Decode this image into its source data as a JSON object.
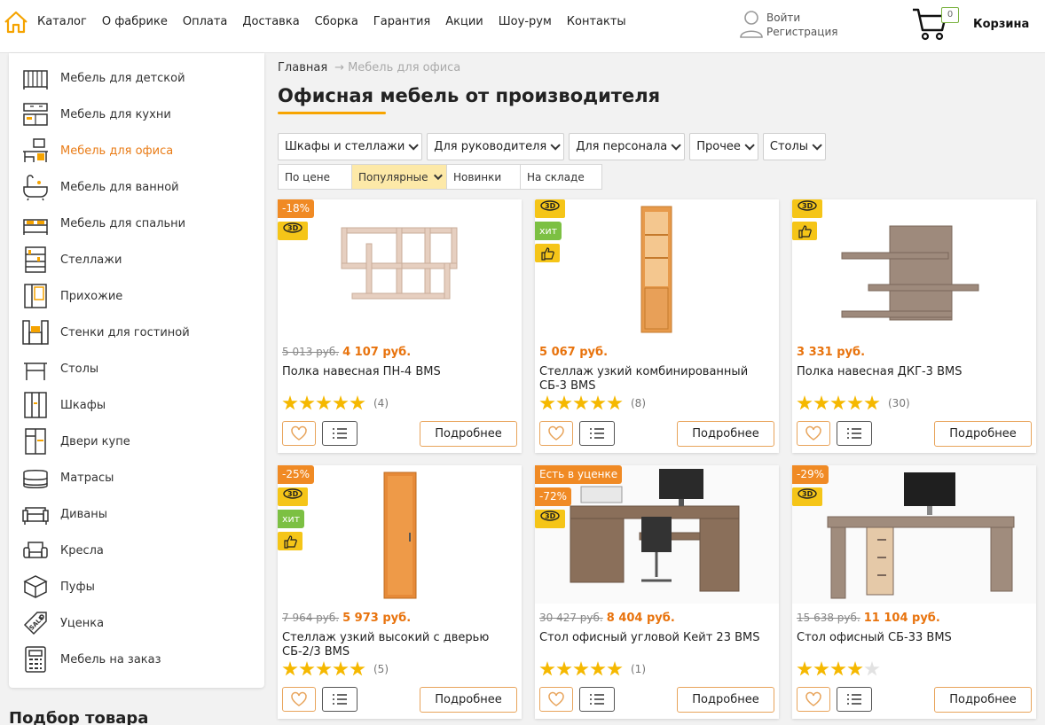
{
  "header": {
    "nav": [
      "Каталог",
      "О фабрике",
      "Оплата",
      "Доставка",
      "Сборка",
      "Гарантия",
      "Акции",
      "Шоу-рум",
      "Контакты"
    ],
    "login": "Войти",
    "register": "Регистрация",
    "cart_count": "0",
    "cart_label": "Корзина"
  },
  "sidebar": {
    "items": [
      {
        "label": "Мебель для детской",
        "icon": "crib-icon"
      },
      {
        "label": "Мебель для кухни",
        "icon": "kitchen-icon"
      },
      {
        "label": "Мебель для офиса",
        "icon": "office-desk-icon"
      },
      {
        "label": "Мебель для ванной",
        "icon": "bathtub-icon"
      },
      {
        "label": "Мебель для спальни",
        "icon": "bed-icon"
      },
      {
        "label": "Стеллажи",
        "icon": "shelving-icon"
      },
      {
        "label": "Прихожие",
        "icon": "hallway-icon"
      },
      {
        "label": "Стенки для гостиной",
        "icon": "wall-unit-icon"
      },
      {
        "label": "Столы",
        "icon": "table-icon"
      },
      {
        "label": "Шкафы",
        "icon": "wardrobe-icon"
      },
      {
        "label": "Двери купе",
        "icon": "sliding-door-icon"
      },
      {
        "label": "Матрасы",
        "icon": "mattress-icon"
      },
      {
        "label": "Диваны",
        "icon": "sofa-icon"
      },
      {
        "label": "Кресла",
        "icon": "armchair-icon"
      },
      {
        "label": "Пуфы",
        "icon": "pouf-icon"
      },
      {
        "label": "Уценка",
        "icon": "sale-tag-icon"
      },
      {
        "label": "Мебель на заказ",
        "icon": "calculator-icon"
      }
    ],
    "active_index": 2,
    "bottom_heading": "Подбор товара"
  },
  "breadcrumb": {
    "home": "Главная",
    "arrow": "→",
    "current": "Мебель для офиса"
  },
  "title": "Офисная мебель от производителя",
  "filters": [
    "Шкафы и стеллажи",
    "Для руководителя",
    "Для персонала",
    "Прочее",
    "Столы"
  ],
  "sorts": [
    {
      "label": "По цене"
    },
    {
      "label": "Популярные"
    },
    {
      "label": "Новинки"
    },
    {
      "label": "На складе"
    }
  ],
  "active_sort": 1,
  "badge_3d": "3D",
  "badge_hit": "хит",
  "more_label": "Подробнее",
  "products": [
    {
      "discount": "-18%",
      "old": "5 013 руб.",
      "new": "4 107 руб.",
      "name": "Полка навесная ПН-4 BMS",
      "rating": 5,
      "reviews": "(4)",
      "badges": [
        "3d"
      ],
      "img": "shelf-light"
    },
    {
      "discount": "",
      "old": "",
      "new": "5 067 руб.",
      "name": "Стеллаж узкий комбинированный СБ-3 BMS",
      "rating": 5,
      "reviews": "(8)",
      "badges": [
        "3d",
        "hit",
        "like"
      ],
      "img": "tall-orange"
    },
    {
      "discount": "",
      "old": "",
      "new": "3 331 руб.",
      "name": "Полка навесная ДКГ-3 BMS",
      "rating": 5,
      "reviews": "(30)",
      "badges": [
        "3d",
        "like"
      ],
      "img": "shelf-brown"
    },
    {
      "discount": "-25%",
      "old": "7 964 руб.",
      "new": "5 973 руб.",
      "name": "Стеллаж узкий высокий с дверью СБ-2/3 BMS",
      "rating": 5,
      "reviews": "(5)",
      "badges": [
        "3d",
        "hit",
        "like"
      ],
      "img": "tall-door"
    },
    {
      "discount": "-72%",
      "uc": "Есть в уценке",
      "old": "30 427 руб.",
      "new": "8 404 руб.",
      "name": "Стол офисный угловой Кейт 23 BMS",
      "rating": 5,
      "reviews": "(1)",
      "badges": [
        "3d"
      ],
      "img": "desk-corner"
    },
    {
      "discount": "-29%",
      "old": "15 638 руб.",
      "new": "11 104 руб.",
      "name": "Стол офисный СБ-33 BMS",
      "rating": 4,
      "reviews": "",
      "badges": [
        "3d"
      ],
      "img": "desk-l"
    }
  ]
}
